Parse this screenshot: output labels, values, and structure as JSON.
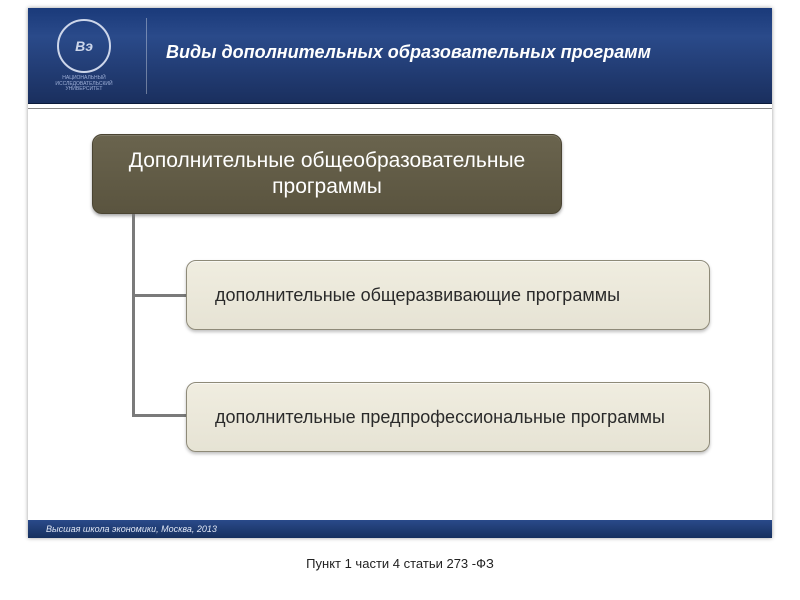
{
  "header": {
    "title": "Виды дополнительных образовательных программ",
    "logo_text": "Вэ",
    "logo_sub": "НАЦИОНАЛЬНЫЙ ИССЛЕДОВАТЕЛЬСКИЙ УНИВЕРСИТЕТ"
  },
  "diagram": {
    "parent": "Дополнительные общеобразовательные программы",
    "children": [
      "дополнительные общеразвивающие программы",
      "дополнительные предпрофессиональные программы"
    ]
  },
  "footer": "Высшая школа экономики, Москва, 2013",
  "caption": "Пункт 1 части 4 статьи 273 -ФЗ"
}
